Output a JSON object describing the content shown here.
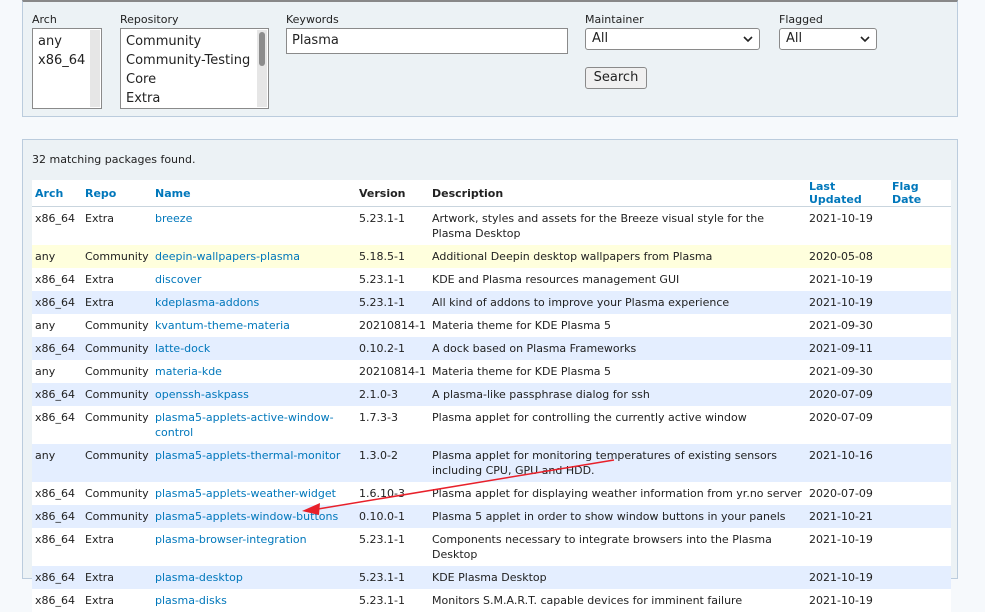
{
  "search": {
    "arch": {
      "label": "Arch",
      "options": [
        "any",
        "x86_64"
      ]
    },
    "repository": {
      "label": "Repository",
      "options": [
        "Community",
        "Community-Testing",
        "Core",
        "Extra"
      ]
    },
    "keywords": {
      "label": "Keywords",
      "value": "Plasma"
    },
    "maintainer": {
      "label": "Maintainer",
      "selected": "All"
    },
    "flagged": {
      "label": "Flagged",
      "selected": "All"
    },
    "search_button": "Search"
  },
  "results": {
    "count_text": "32 matching packages found.",
    "columns": {
      "arch": "Arch",
      "repo": "Repo",
      "name": "Name",
      "version": "Version",
      "description": "Description",
      "last_updated": "Last Updated",
      "flag_date": "Flag Date"
    },
    "rows": [
      {
        "arch": "x86_64",
        "repo": "Extra",
        "name": "breeze",
        "version": "5.23.1-1",
        "description": "Artwork, styles and assets for the Breeze visual style for the Plasma Desktop",
        "last_updated": "2021-10-19",
        "flag_date": ""
      },
      {
        "arch": "any",
        "repo": "Community",
        "name": "deepin-wallpapers-plasma",
        "version": "5.18.5-1",
        "description": "Additional Deepin desktop wallpapers from Plasma",
        "last_updated": "2020-05-08",
        "flag_date": ""
      },
      {
        "arch": "x86_64",
        "repo": "Extra",
        "name": "discover",
        "version": "5.23.1-1",
        "description": "KDE and Plasma resources management GUI",
        "last_updated": "2021-10-19",
        "flag_date": ""
      },
      {
        "arch": "x86_64",
        "repo": "Extra",
        "name": "kdeplasma-addons",
        "version": "5.23.1-1",
        "description": "All kind of addons to improve your Plasma experience",
        "last_updated": "2021-10-19",
        "flag_date": ""
      },
      {
        "arch": "any",
        "repo": "Community",
        "name": "kvantum-theme-materia",
        "version": "20210814-1",
        "description": "Materia theme for KDE Plasma 5",
        "last_updated": "2021-09-30",
        "flag_date": ""
      },
      {
        "arch": "x86_64",
        "repo": "Community",
        "name": "latte-dock",
        "version": "0.10.2-1",
        "description": "A dock based on Plasma Frameworks",
        "last_updated": "2021-09-11",
        "flag_date": ""
      },
      {
        "arch": "any",
        "repo": "Community",
        "name": "materia-kde",
        "version": "20210814-1",
        "description": "Materia theme for KDE Plasma 5",
        "last_updated": "2021-09-30",
        "flag_date": ""
      },
      {
        "arch": "x86_64",
        "repo": "Community",
        "name": "openssh-askpass",
        "version": "2.1.0-3",
        "description": "A plasma-like passphrase dialog for ssh",
        "last_updated": "2020-07-09",
        "flag_date": ""
      },
      {
        "arch": "x86_64",
        "repo": "Community",
        "name": "plasma5-applets-active-window-control",
        "version": "1.7.3-3",
        "description": "Plasma applet for controlling the currently active window",
        "last_updated": "2020-07-09",
        "flag_date": ""
      },
      {
        "arch": "any",
        "repo": "Community",
        "name": "plasma5-applets-thermal-monitor",
        "version": "1.3.0-2",
        "description": "Plasma applet for monitoring temperatures of existing sensors including CPU, GPU and HDD.",
        "last_updated": "2021-10-16",
        "flag_date": ""
      },
      {
        "arch": "x86_64",
        "repo": "Community",
        "name": "plasma5-applets-weather-widget",
        "version": "1.6.10-3",
        "description": "Plasma applet for displaying weather information from yr.no server",
        "last_updated": "2020-07-09",
        "flag_date": ""
      },
      {
        "arch": "x86_64",
        "repo": "Community",
        "name": "plasma5-applets-window-buttons",
        "version": "0.10.0-1",
        "description": "Plasma 5 applet in order to show window buttons in your panels",
        "last_updated": "2021-10-21",
        "flag_date": ""
      },
      {
        "arch": "x86_64",
        "repo": "Extra",
        "name": "plasma-browser-integration",
        "version": "5.23.1-1",
        "description": "Components necessary to integrate browsers into the Plasma Desktop",
        "last_updated": "2021-10-19",
        "flag_date": ""
      },
      {
        "arch": "x86_64",
        "repo": "Extra",
        "name": "plasma-desktop",
        "version": "5.23.1-1",
        "description": "KDE Plasma Desktop",
        "last_updated": "2021-10-19",
        "flag_date": ""
      },
      {
        "arch": "x86_64",
        "repo": "Extra",
        "name": "plasma-disks",
        "version": "5.23.1-1",
        "description": "Monitors S.M.A.R.T. capable devices for imminent failure",
        "last_updated": "2021-10-19",
        "flag_date": ""
      }
    ]
  },
  "colors": {
    "link": "#0077bb",
    "row_alt": "#e4eeff",
    "row_highlight": "#ffffdd",
    "annotation_arrow": "#e8202a"
  }
}
